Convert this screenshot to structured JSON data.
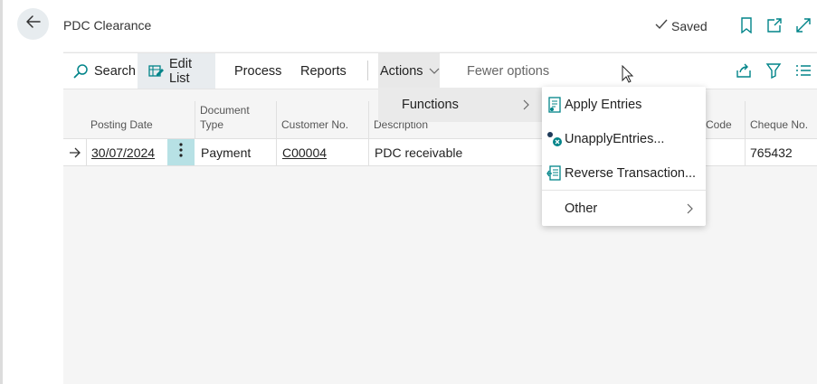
{
  "header": {
    "title": "PDC Clearance",
    "saved_label": "Saved"
  },
  "toolbar": {
    "search_label": "Search",
    "edit_list_label": "Edit List",
    "process_label": "Process",
    "reports_label": "Reports",
    "actions_label": "Actions",
    "fewer_options_label": "Fewer options"
  },
  "columns": {
    "posting_date": "Posting Date",
    "document_type_1": "Document",
    "document_type_2": "Type",
    "customer_no": "Customer No.",
    "description": "Description",
    "code": "Code",
    "cheque_no": "Cheque No."
  },
  "row": {
    "posting_date": "30/07/2024",
    "document_type": "Payment",
    "customer_no": "C00004",
    "description": "PDC receivable",
    "cheque_no": "765432"
  },
  "actions_menu": {
    "functions_label": "Functions"
  },
  "functions_submenu": {
    "apply_entries": "Apply Entries",
    "unapply_entries": "UnapplyEntries...",
    "reverse_transaction": "Reverse Transaction...",
    "other": "Other"
  },
  "colors": {
    "accent": "#008489",
    "row_menu_bg": "#b7e1e5"
  }
}
